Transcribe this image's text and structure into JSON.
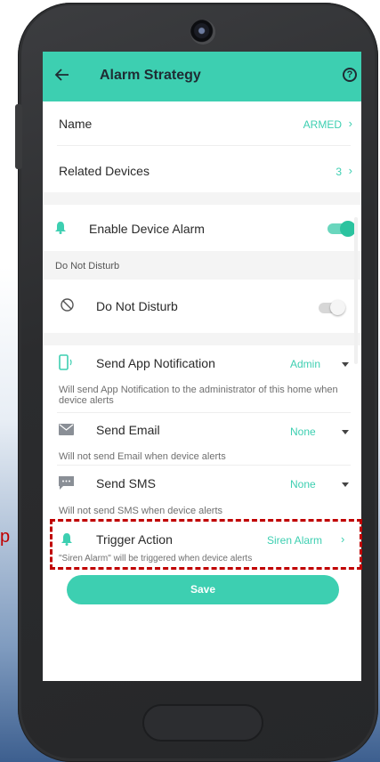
{
  "header": {
    "title": "Alarm Strategy",
    "back_icon": "arrow-left-icon",
    "help_icon": "question-circle-icon",
    "help_glyph": "?"
  },
  "rows": {
    "name": {
      "label": "Name",
      "value": "ARMED"
    },
    "related_devices": {
      "label": "Related Devices",
      "value": "3"
    },
    "enable_alarm": {
      "label": "Enable Device Alarm",
      "enabled": true
    },
    "dnd_section": {
      "label": "Do Not Disturb"
    },
    "dnd": {
      "label": "Do Not Disturb",
      "enabled": false
    },
    "app_notification": {
      "label": "Send App Notification",
      "value": "Admin",
      "description": "Will send App Notification to the administrator of this home when device alerts"
    },
    "email": {
      "label": "Send Email",
      "value": "None",
      "description": "Will not send Email when device alerts"
    },
    "sms": {
      "label": "Send SMS",
      "value": "None",
      "description": "Will not send SMS when device alerts"
    },
    "trigger": {
      "label": "Trigger Action",
      "value": "Siren Alarm",
      "description": "\"Siren Alarm\" will be triggered when device alerts"
    }
  },
  "save_label": "Save",
  "annotation": {
    "side_text": "p"
  },
  "colors": {
    "accent": "#3dcfb1",
    "highlight": "#c00000"
  }
}
